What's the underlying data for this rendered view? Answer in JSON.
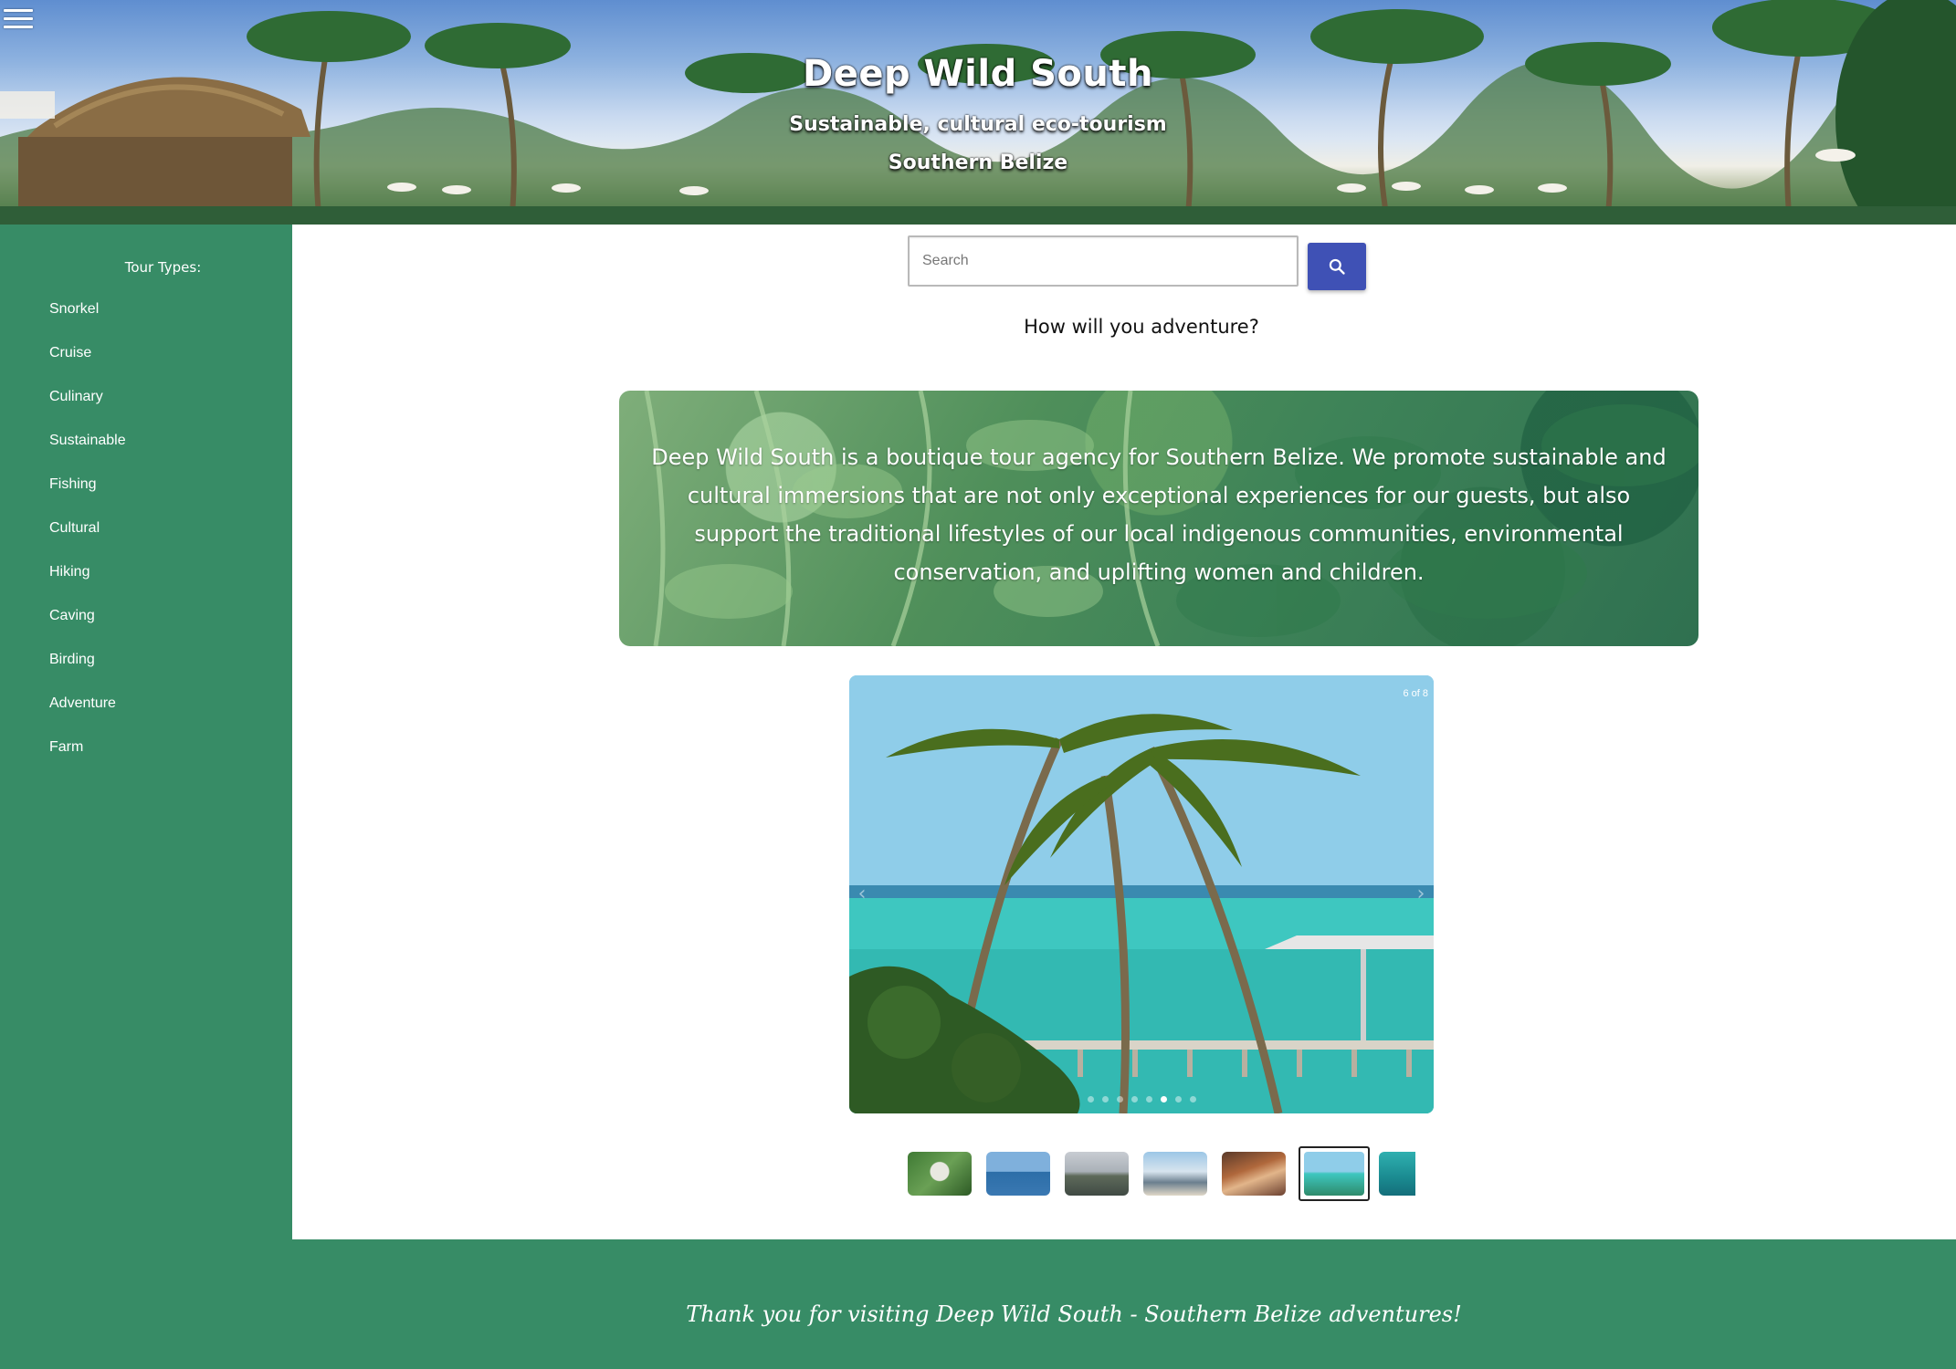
{
  "header": {
    "title": "Deep Wild South",
    "subtitle": "Sustainable, cultural eco-tourism",
    "region": "Southern Belize",
    "menu_icon": "hamburger-menu-icon"
  },
  "sidebar": {
    "heading": "Tour Types:",
    "items": [
      "Snorkel",
      "Cruise",
      "Culinary",
      "Sustainable",
      "Fishing",
      "Cultural",
      "Hiking",
      "Caving",
      "Birding",
      "Adventure",
      "Farm"
    ]
  },
  "search": {
    "placeholder": "Search",
    "value": "",
    "button_icon": "search-icon"
  },
  "tagline": "How will you adventure?",
  "about": {
    "text": "Deep Wild South is a boutique tour agency for Southern Belize. We promote sustainable and cultural immersions that are not only exceptional experiences for our guests, but also support the traditional lifestyles of our local indigenous communities, environmental conservation, and uplifting women and children."
  },
  "gallery": {
    "counter": "6 of 8",
    "current_index": 6,
    "total": 8,
    "prev_icon": "chevron-left-icon",
    "next_icon": "chevron-right-icon"
  },
  "footer": {
    "text": "Thank you for visiting Deep Wild South - Southern Belize adventures!"
  },
  "colors": {
    "brand_green": "#378c66",
    "search_button": "#3f51b5",
    "white": "#ffffff"
  }
}
